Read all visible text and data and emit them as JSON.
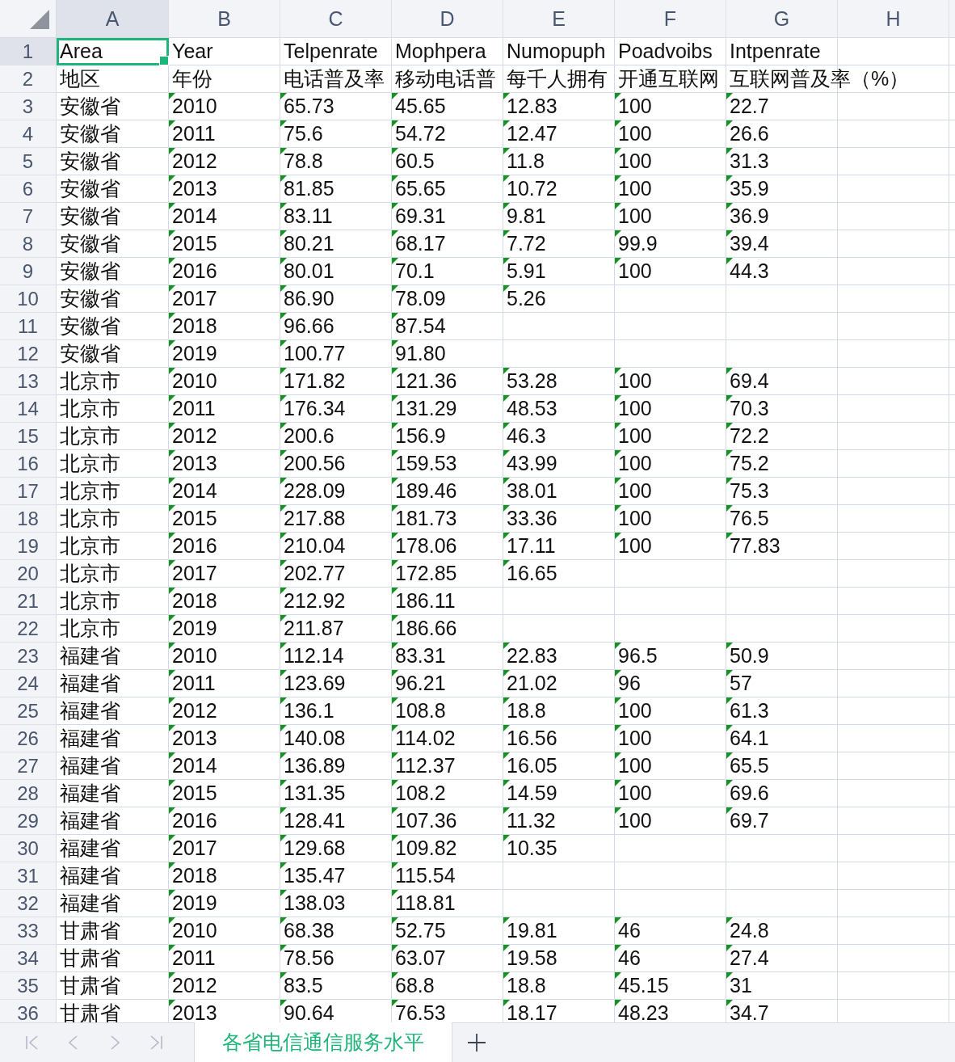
{
  "columns": [
    {
      "label": "A",
      "selected": true
    },
    {
      "label": "B",
      "selected": false
    },
    {
      "label": "C",
      "selected": false
    },
    {
      "label": "D",
      "selected": false
    },
    {
      "label": "E",
      "selected": false
    },
    {
      "label": "F",
      "selected": false
    },
    {
      "label": "G",
      "selected": false
    },
    {
      "label": "H",
      "selected": false
    }
  ],
  "rows": [
    {
      "number": "1",
      "selected": true,
      "text_number_flags": false,
      "cells": [
        "Area",
        "Year",
        "Telpenrate",
        "Mophpera",
        "Numopuph",
        "Poadvoibs",
        "Intpenrate"
      ]
    },
    {
      "number": "2",
      "selected": false,
      "text_number_flags": false,
      "cells": [
        "地区",
        "年份",
        "电话普及率",
        "移动电话普",
        "每千人拥有",
        "开通互联网",
        "互联网普及率（%）"
      ]
    },
    {
      "number": "3",
      "selected": false,
      "text_number_flags": true,
      "cells": [
        "安徽省",
        "2010",
        "65.73",
        "45.65",
        "12.83",
        "100",
        "22.7"
      ]
    },
    {
      "number": "4",
      "selected": false,
      "text_number_flags": true,
      "cells": [
        "安徽省",
        "2011",
        "75.6",
        "54.72",
        "12.47",
        "100",
        "26.6"
      ]
    },
    {
      "number": "5",
      "selected": false,
      "text_number_flags": true,
      "cells": [
        "安徽省",
        "2012",
        "78.8",
        "60.5",
        "11.8",
        "100",
        "31.3"
      ]
    },
    {
      "number": "6",
      "selected": false,
      "text_number_flags": true,
      "cells": [
        "安徽省",
        "2013",
        "81.85",
        "65.65",
        "10.72",
        "100",
        "35.9"
      ]
    },
    {
      "number": "7",
      "selected": false,
      "text_number_flags": true,
      "cells": [
        "安徽省",
        "2014",
        "83.11",
        "69.31",
        "9.81",
        "100",
        "36.9"
      ]
    },
    {
      "number": "8",
      "selected": false,
      "text_number_flags": true,
      "cells": [
        "安徽省",
        "2015",
        "80.21",
        "68.17",
        "7.72",
        "99.9",
        "39.4"
      ]
    },
    {
      "number": "9",
      "selected": false,
      "text_number_flags": true,
      "cells": [
        "安徽省",
        "2016",
        "80.01",
        "70.1",
        "5.91",
        "100",
        "44.3"
      ]
    },
    {
      "number": "10",
      "selected": false,
      "text_number_flags": true,
      "cells": [
        "安徽省",
        "2017",
        "86.90",
        "78.09",
        "5.26"
      ]
    },
    {
      "number": "11",
      "selected": false,
      "text_number_flags": true,
      "cells": [
        "安徽省",
        "2018",
        "96.66",
        "87.54"
      ]
    },
    {
      "number": "12",
      "selected": false,
      "text_number_flags": true,
      "cells": [
        "安徽省",
        "2019",
        "100.77",
        "91.80"
      ]
    },
    {
      "number": "13",
      "selected": false,
      "text_number_flags": true,
      "cells": [
        "北京市",
        "2010",
        "171.82",
        "121.36",
        "53.28",
        "100",
        "69.4"
      ]
    },
    {
      "number": "14",
      "selected": false,
      "text_number_flags": true,
      "cells": [
        "北京市",
        "2011",
        "176.34",
        "131.29",
        "48.53",
        "100",
        "70.3"
      ]
    },
    {
      "number": "15",
      "selected": false,
      "text_number_flags": true,
      "cells": [
        "北京市",
        "2012",
        "200.6",
        "156.9",
        "46.3",
        "100",
        "72.2"
      ]
    },
    {
      "number": "16",
      "selected": false,
      "text_number_flags": true,
      "cells": [
        "北京市",
        "2013",
        "200.56",
        "159.53",
        "43.99",
        "100",
        "75.2"
      ]
    },
    {
      "number": "17",
      "selected": false,
      "text_number_flags": true,
      "cells": [
        "北京市",
        "2014",
        "228.09",
        "189.46",
        "38.01",
        "100",
        "75.3"
      ]
    },
    {
      "number": "18",
      "selected": false,
      "text_number_flags": true,
      "cells": [
        "北京市",
        "2015",
        "217.88",
        "181.73",
        "33.36",
        "100",
        "76.5"
      ]
    },
    {
      "number": "19",
      "selected": false,
      "text_number_flags": true,
      "cells": [
        "北京市",
        "2016",
        "210.04",
        "178.06",
        "17.11",
        "100",
        "77.83"
      ]
    },
    {
      "number": "20",
      "selected": false,
      "text_number_flags": true,
      "cells": [
        "北京市",
        "2017",
        "202.77",
        "172.85",
        "16.65"
      ]
    },
    {
      "number": "21",
      "selected": false,
      "text_number_flags": true,
      "cells": [
        "北京市",
        "2018",
        "212.92",
        "186.11"
      ]
    },
    {
      "number": "22",
      "selected": false,
      "text_number_flags": true,
      "cells": [
        "北京市",
        "2019",
        "211.87",
        "186.66"
      ]
    },
    {
      "number": "23",
      "selected": false,
      "text_number_flags": true,
      "cells": [
        "福建省",
        "2010",
        "112.14",
        "83.31",
        "22.83",
        "96.5",
        "50.9"
      ]
    },
    {
      "number": "24",
      "selected": false,
      "text_number_flags": true,
      "cells": [
        "福建省",
        "2011",
        "123.69",
        "96.21",
        "21.02",
        "96",
        "57"
      ]
    },
    {
      "number": "25",
      "selected": false,
      "text_number_flags": true,
      "cells": [
        "福建省",
        "2012",
        "136.1",
        "108.8",
        "18.8",
        "100",
        "61.3"
      ]
    },
    {
      "number": "26",
      "selected": false,
      "text_number_flags": true,
      "cells": [
        "福建省",
        "2013",
        "140.08",
        "114.02",
        "16.56",
        "100",
        "64.1"
      ]
    },
    {
      "number": "27",
      "selected": false,
      "text_number_flags": true,
      "cells": [
        "福建省",
        "2014",
        "136.89",
        "112.37",
        "16.05",
        "100",
        "65.5"
      ]
    },
    {
      "number": "28",
      "selected": false,
      "text_number_flags": true,
      "cells": [
        "福建省",
        "2015",
        "131.35",
        "108.2",
        "14.59",
        "100",
        "69.6"
      ]
    },
    {
      "number": "29",
      "selected": false,
      "text_number_flags": true,
      "cells": [
        "福建省",
        "2016",
        "128.41",
        "107.36",
        "11.32",
        "100",
        "69.7"
      ]
    },
    {
      "number": "30",
      "selected": false,
      "text_number_flags": true,
      "cells": [
        "福建省",
        "2017",
        "129.68",
        "109.82",
        "10.35"
      ]
    },
    {
      "number": "31",
      "selected": false,
      "text_number_flags": true,
      "cells": [
        "福建省",
        "2018",
        "135.47",
        "115.54"
      ]
    },
    {
      "number": "32",
      "selected": false,
      "text_number_flags": true,
      "cells": [
        "福建省",
        "2019",
        "138.03",
        "118.81"
      ]
    },
    {
      "number": "33",
      "selected": false,
      "text_number_flags": true,
      "cells": [
        "甘肃省",
        "2010",
        "68.38",
        "52.75",
        "19.81",
        "46",
        "24.8"
      ]
    },
    {
      "number": "34",
      "selected": false,
      "text_number_flags": true,
      "cells": [
        "甘肃省",
        "2011",
        "78.56",
        "63.07",
        "19.58",
        "46",
        "27.4"
      ]
    },
    {
      "number": "35",
      "selected": false,
      "text_number_flags": true,
      "cells": [
        "甘肃省",
        "2012",
        "83.5",
        "68.8",
        "18.8",
        "45.15",
        "31"
      ]
    },
    {
      "number": "36",
      "selected": false,
      "text_number_flags": true,
      "cells": [
        "甘肃省",
        "2013",
        "90.64",
        "76.53",
        "18.17",
        "48.23",
        "34.7"
      ]
    }
  ],
  "sheet_tabs": [
    {
      "label": "各省电信通信服务水平",
      "selected": true
    }
  ]
}
